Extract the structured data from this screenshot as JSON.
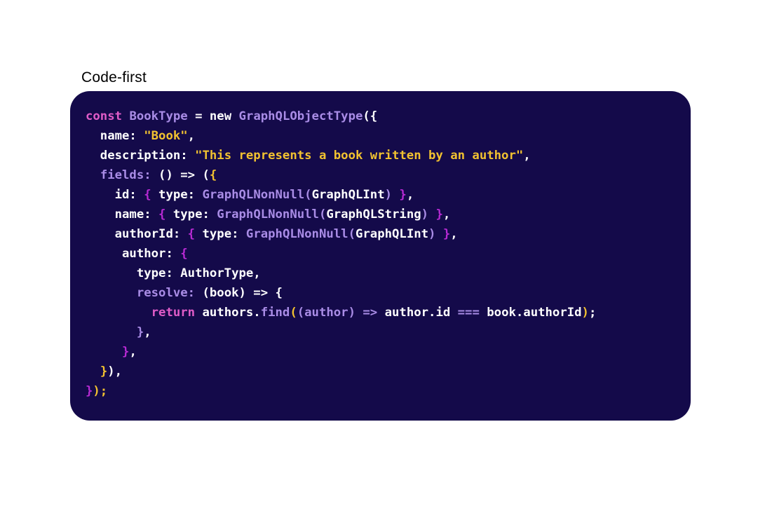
{
  "caption": "Code-first",
  "colors": {
    "card_background": "#140a4a",
    "keyword": "#e05cc8",
    "type": "#a98ce6",
    "string": "#f2c230",
    "default": "#ffffff",
    "bracket_magenta": "#b82ad4",
    "bracket_yellow": "#f2c230",
    "property_muted": "#a98ce6"
  },
  "code_lines": [
    [
      {
        "t": "const ",
        "c": "keyword"
      },
      {
        "t": "BookType",
        "c": "type"
      },
      {
        "t": " = new ",
        "c": "default"
      },
      {
        "t": "GraphQLObjectType",
        "c": "type"
      },
      {
        "t": "({",
        "c": "default"
      }
    ],
    [
      {
        "t": "  name: ",
        "c": "default"
      },
      {
        "t": "\"Book\"",
        "c": "string"
      },
      {
        "t": ",",
        "c": "default"
      }
    ],
    [
      {
        "t": "  description: ",
        "c": "default"
      },
      {
        "t": "\"This represents a book written by an author\"",
        "c": "string"
      },
      {
        "t": ",",
        "c": "default"
      }
    ],
    [
      {
        "t": "  ",
        "c": "default"
      },
      {
        "t": "fields:",
        "c": "property_muted"
      },
      {
        "t": " () => (",
        "c": "default"
      },
      {
        "t": "{",
        "c": "bracket_yellow"
      }
    ],
    [
      {
        "t": "    id: ",
        "c": "default"
      },
      {
        "t": "{",
        "c": "bracket_magenta"
      },
      {
        "t": " type: ",
        "c": "default"
      },
      {
        "t": "GraphQLNonNull(",
        "c": "type"
      },
      {
        "t": "GraphQLInt",
        "c": "default"
      },
      {
        "t": ") ",
        "c": "type"
      },
      {
        "t": "}",
        "c": "bracket_magenta"
      },
      {
        "t": ",",
        "c": "default"
      }
    ],
    [
      {
        "t": "    name: ",
        "c": "default"
      },
      {
        "t": "{",
        "c": "bracket_magenta"
      },
      {
        "t": " type: ",
        "c": "default"
      },
      {
        "t": "GraphQLNonNull(",
        "c": "type"
      },
      {
        "t": "GraphQLString",
        "c": "default"
      },
      {
        "t": ") ",
        "c": "type"
      },
      {
        "t": "}",
        "c": "bracket_magenta"
      },
      {
        "t": ",",
        "c": "default"
      }
    ],
    [
      {
        "t": "    authorId: ",
        "c": "default"
      },
      {
        "t": "{",
        "c": "bracket_magenta"
      },
      {
        "t": " type: ",
        "c": "default"
      },
      {
        "t": "GraphQLNonNull(",
        "c": "type"
      },
      {
        "t": "GraphQLInt",
        "c": "default"
      },
      {
        "t": ") ",
        "c": "type"
      },
      {
        "t": "}",
        "c": "bracket_magenta"
      },
      {
        "t": ",",
        "c": "default"
      }
    ],
    [
      {
        "t": "     author: ",
        "c": "default"
      },
      {
        "t": "{",
        "c": "bracket_magenta"
      }
    ],
    [
      {
        "t": "       type: AuthorType,",
        "c": "default"
      }
    ],
    [
      {
        "t": "       ",
        "c": "default"
      },
      {
        "t": "resolve:",
        "c": "property_muted"
      },
      {
        "t": " (book) => {",
        "c": "default"
      }
    ],
    [
      {
        "t": "         ",
        "c": "default"
      },
      {
        "t": "return",
        "c": "keyword"
      },
      {
        "t": " authors.",
        "c": "default"
      },
      {
        "t": "find",
        "c": "type"
      },
      {
        "t": "(",
        "c": "bracket_yellow"
      },
      {
        "t": "(author) => ",
        "c": "type"
      },
      {
        "t": "author.id ",
        "c": "default"
      },
      {
        "t": "===",
        "c": "type"
      },
      {
        "t": " book.authorId",
        "c": "default"
      },
      {
        "t": ")",
        "c": "bracket_yellow"
      },
      {
        "t": ";",
        "c": "default"
      }
    ],
    [
      {
        "t": "       ",
        "c": "default"
      },
      {
        "t": "}",
        "c": "property_muted"
      },
      {
        "t": ",",
        "c": "default"
      }
    ],
    [
      {
        "t": "     ",
        "c": "default"
      },
      {
        "t": "}",
        "c": "bracket_magenta"
      },
      {
        "t": ",",
        "c": "default"
      }
    ],
    [
      {
        "t": "  ",
        "c": "default"
      },
      {
        "t": "}",
        "c": "bracket_yellow"
      },
      {
        "t": "),",
        "c": "default"
      }
    ],
    [
      {
        "t": "}",
        "c": "bracket_magenta"
      },
      {
        "t": ");",
        "c": "bracket_yellow"
      }
    ]
  ]
}
